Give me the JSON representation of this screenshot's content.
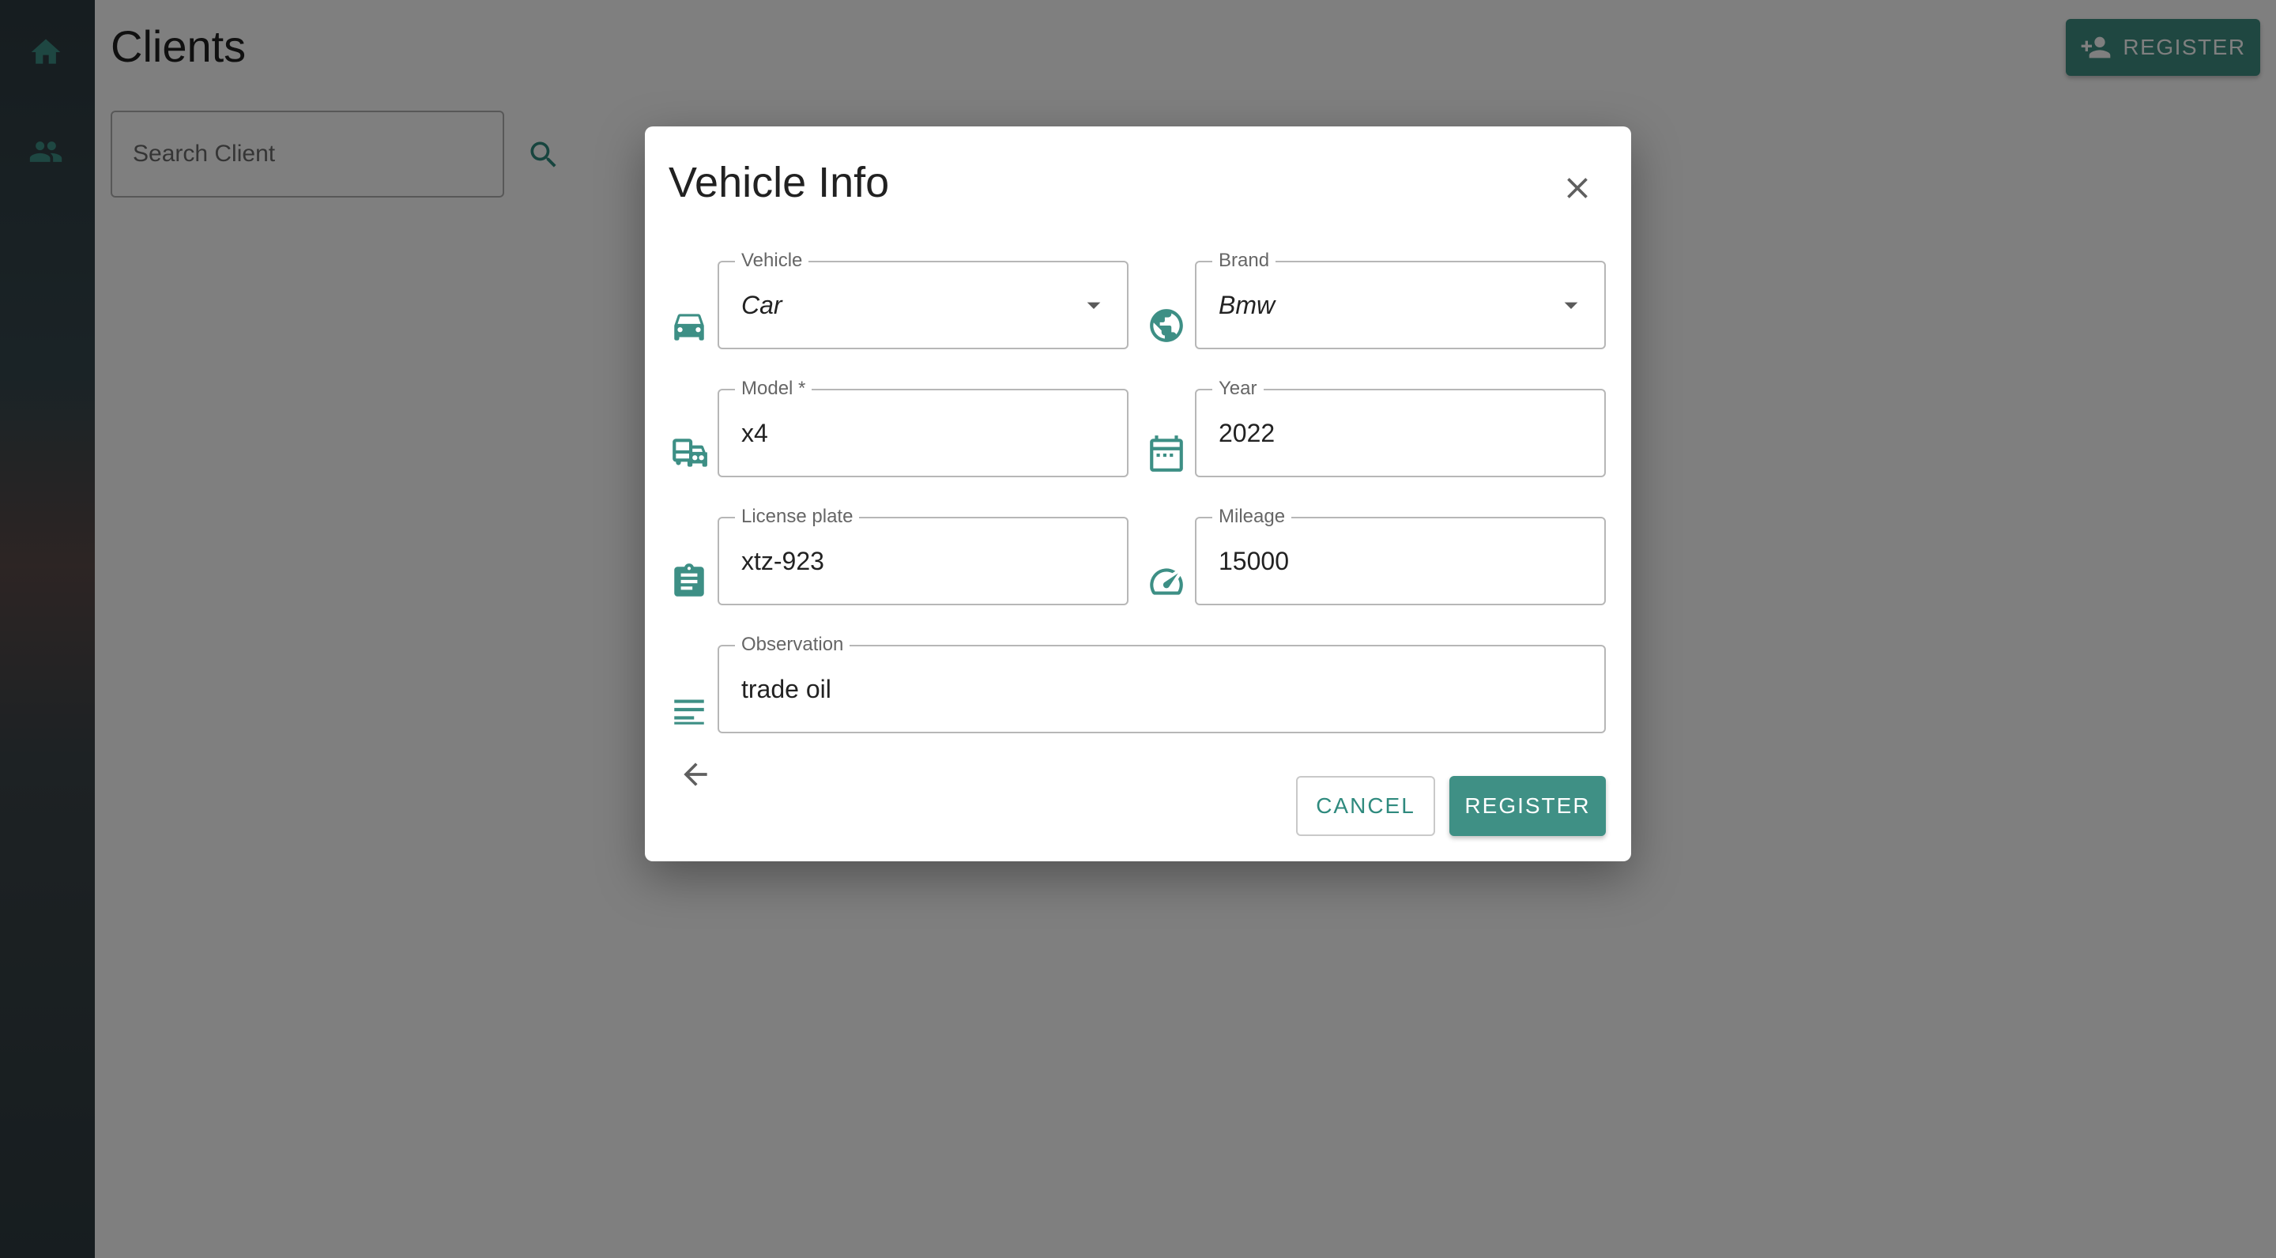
{
  "sidebar": {
    "items": [
      {
        "icon": "home-icon"
      },
      {
        "icon": "people-icon"
      }
    ]
  },
  "page": {
    "title": "Clients",
    "search_placeholder": "Search Client",
    "register_label": "REGISTER"
  },
  "dialog": {
    "title": "Vehicle Info",
    "fields": {
      "vehicle": {
        "label": "Vehicle",
        "value": "Car",
        "icon": "car-icon"
      },
      "brand": {
        "label": "Brand",
        "value": "Bmw",
        "icon": "globe-icon"
      },
      "model": {
        "label": "Model *",
        "value": "x4",
        "icon": "transport-icon"
      },
      "year": {
        "label": "Year",
        "value": "2022",
        "icon": "calendar-icon"
      },
      "license_plate": {
        "label": "License plate",
        "value": "xtz-923",
        "icon": "clipboard-icon"
      },
      "mileage": {
        "label": "Mileage",
        "value": "15000",
        "icon": "speedometer-icon"
      },
      "observation": {
        "label": "Observation",
        "value": "trade oil",
        "icon": "notes-icon"
      }
    },
    "cancel_label": "CANCEL",
    "register_label": "REGISTER"
  },
  "colors": {
    "accent": "#3f9085",
    "overlay": "rgba(0,0,0,0.5)"
  }
}
